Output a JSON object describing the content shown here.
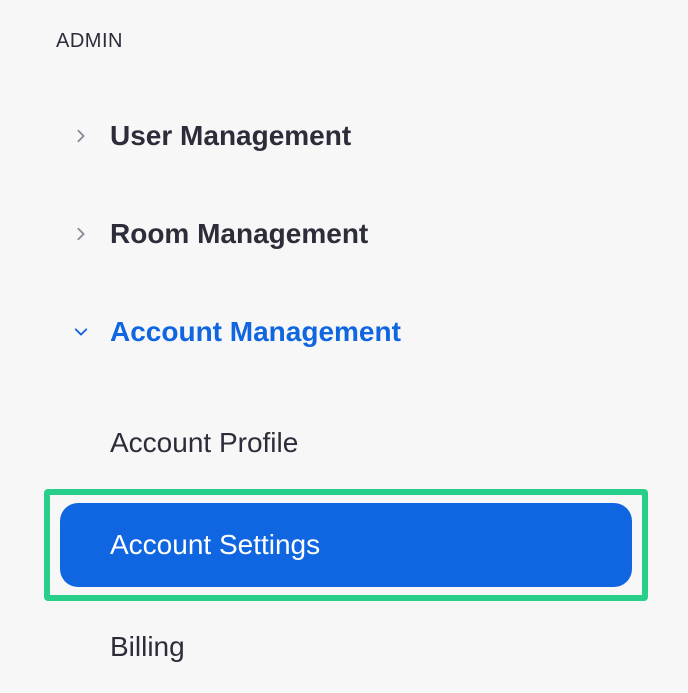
{
  "section": {
    "header": "ADMIN"
  },
  "nav": {
    "items": [
      {
        "label": "User Management"
      },
      {
        "label": "Room Management"
      },
      {
        "label": "Account Management"
      }
    ]
  },
  "subnav": {
    "items": [
      {
        "label": "Account Profile"
      },
      {
        "label": "Account Settings"
      },
      {
        "label": "Billing"
      }
    ]
  },
  "colors": {
    "accent": "#1066e0",
    "highlight_border": "#28cf8b",
    "text": "#2d2d3a",
    "background": "#f7f7f8"
  }
}
